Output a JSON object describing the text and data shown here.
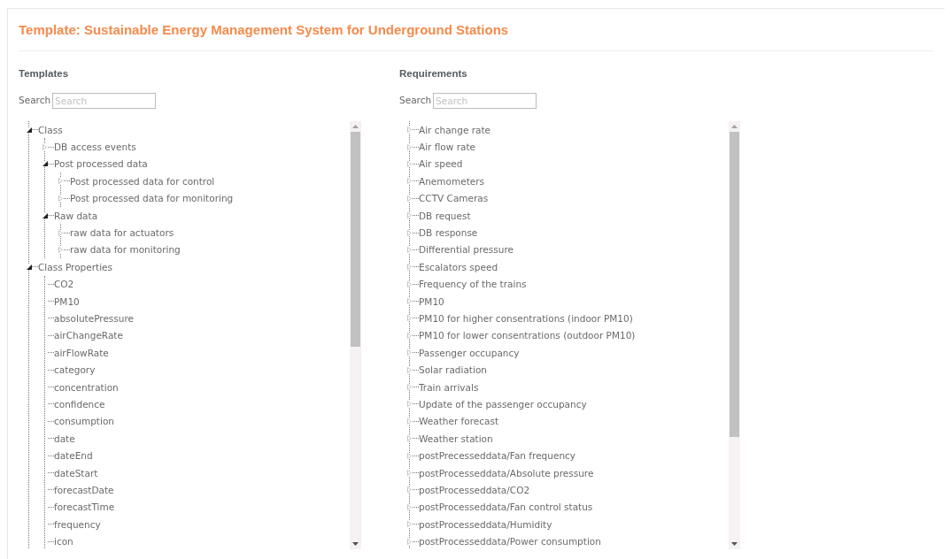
{
  "title": "Template: Sustainable Energy Management System for Underground Stations",
  "columns": [
    {
      "heading": "Templates",
      "search": {
        "label": "Search",
        "placeholder": "Search"
      },
      "tree": [
        {
          "label": "Class",
          "expanded": true,
          "children": [
            {
              "label": "DB access events",
              "expanded": false
            },
            {
              "label": "Post processed data",
              "expanded": true,
              "children": [
                {
                  "label": "Post processed data for control",
                  "expanded": false
                },
                {
                  "label": "Post processed data for monitoring",
                  "expanded": false
                }
              ]
            },
            {
              "label": "Raw data",
              "expanded": true,
              "children": [
                {
                  "label": "raw data for actuators",
                  "expanded": false
                },
                {
                  "label": "raw data for monitoring",
                  "expanded": false
                }
              ]
            }
          ]
        },
        {
          "label": "Class Properties",
          "expanded": true,
          "children": [
            {
              "label": "CO2"
            },
            {
              "label": "PM10"
            },
            {
              "label": "absolutePressure"
            },
            {
              "label": "airChangeRate"
            },
            {
              "label": "airFlowRate"
            },
            {
              "label": "category"
            },
            {
              "label": "concentration"
            },
            {
              "label": "confidence"
            },
            {
              "label": "consumption"
            },
            {
              "label": "date"
            },
            {
              "label": "dateEnd"
            },
            {
              "label": "dateStart"
            },
            {
              "label": "forecastDate"
            },
            {
              "label": "forecastTime"
            },
            {
              "label": "frequency"
            },
            {
              "label": "icon"
            }
          ]
        }
      ]
    },
    {
      "heading": "Requirements",
      "search": {
        "label": "Search",
        "placeholder": "Search"
      },
      "tree": [
        {
          "label": "Air change rate",
          "expanded": false
        },
        {
          "label": "Air flow rate",
          "expanded": false
        },
        {
          "label": "Air speed",
          "expanded": false
        },
        {
          "label": "Anemometers",
          "expanded": false
        },
        {
          "label": "CCTV Cameras",
          "expanded": false
        },
        {
          "label": "DB request",
          "expanded": false
        },
        {
          "label": "DB response",
          "expanded": false
        },
        {
          "label": "Differential pressure",
          "expanded": false
        },
        {
          "label": "Escalators speed",
          "expanded": false
        },
        {
          "label": "Frequency of the trains",
          "expanded": false
        },
        {
          "label": "PM10",
          "expanded": false
        },
        {
          "label": "PM10 for higher consentrations (indoor PM10)",
          "expanded": false
        },
        {
          "label": "PM10 for lower consentrations (outdoor PM10)",
          "expanded": false
        },
        {
          "label": "Passenger occupancy",
          "expanded": false
        },
        {
          "label": "Solar radiation",
          "expanded": false
        },
        {
          "label": "Train arrivals",
          "expanded": false
        },
        {
          "label": "Update of the passenger occupancy",
          "expanded": false
        },
        {
          "label": "Weather forecast",
          "expanded": false
        },
        {
          "label": "Weather station",
          "expanded": false
        },
        {
          "label": "postPrecesseddata/Fan frequency",
          "expanded": false
        },
        {
          "label": "postProcesseddata/Absolute pressure",
          "expanded": false
        },
        {
          "label": "postProcesseddata/CO2",
          "expanded": false
        },
        {
          "label": "postProcesseddata/Fan control status",
          "expanded": false
        },
        {
          "label": "postProcesseddata/Humidity",
          "expanded": false
        },
        {
          "label": "postProcesseddata/Power consumption",
          "expanded": false
        }
      ]
    }
  ]
}
